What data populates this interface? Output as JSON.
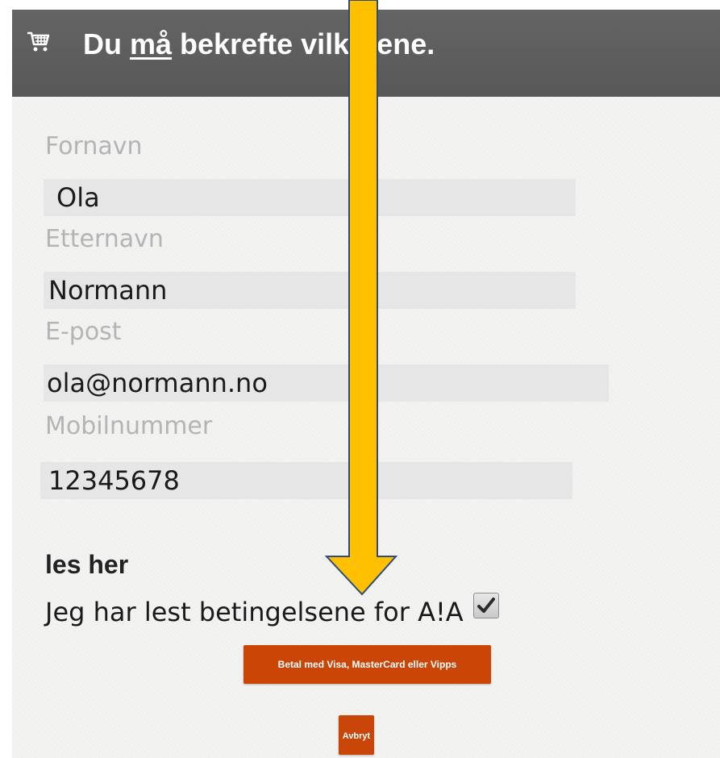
{
  "header": {
    "icon": "shopping-cart-icon",
    "title_pre": "Du ",
    "title_emph": "må",
    "title_post": " bekrefte vilkårene."
  },
  "form": {
    "first_name": {
      "label": "Fornavn",
      "value": "Ola"
    },
    "last_name": {
      "label": "Etternavn",
      "value": "Normann"
    },
    "email": {
      "label": "E-post",
      "value": "ola@normann.no"
    },
    "mobile": {
      "label": "Mobilnummer",
      "value": "12345678"
    }
  },
  "terms": {
    "heading": "les her",
    "checkbox_label": "Jeg har lest betingelsene for A!A",
    "checked": true
  },
  "buttons": {
    "pay": "Betal med Visa, MasterCard eller Vipps",
    "cancel": "Avbryt"
  },
  "annotation": {
    "icon": "arrow-down-icon",
    "color": "#FFC000"
  }
}
